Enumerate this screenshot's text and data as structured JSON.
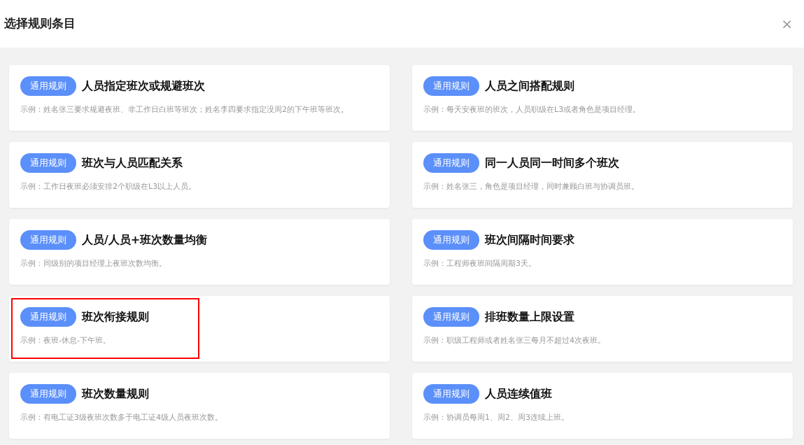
{
  "dialog": {
    "title": "选择规则条目",
    "close": "×"
  },
  "rules": [
    {
      "tag": "通用规则",
      "title": "人员指定班次或规避班次",
      "example": "示例：姓名张三要求规避夜班、非工作日白班等班次；姓名李四要求指定没周2的下午班等班次。",
      "highlighted": false
    },
    {
      "tag": "通用规则",
      "title": "人员之间搭配规则",
      "example": "示例：每天安夜班的班次，人员职级在L3或者角色是项目经理。",
      "highlighted": false
    },
    {
      "tag": "通用规则",
      "title": "班次与人员匹配关系",
      "example": "示例：工作日夜班必须安排2个职级在L3以上人员。",
      "highlighted": false
    },
    {
      "tag": "通用规则",
      "title": "同一人员同一时间多个班次",
      "example": "示例：姓名张三，角色是项目经理，同时兼顾白班与协调员班。",
      "highlighted": false
    },
    {
      "tag": "通用规则",
      "title": "人员/人员+班次数量均衡",
      "example": "示例：同级别的项目经理上夜班次数均衡。",
      "highlighted": false
    },
    {
      "tag": "通用规则",
      "title": "班次间隔时间要求",
      "example": "示例：工程师夜班间隔周期3天。",
      "highlighted": false
    },
    {
      "tag": "通用规则",
      "title": "班次衔接规则",
      "example": "示例：夜班-休息-下午班。",
      "highlighted": true
    },
    {
      "tag": "通用规则",
      "title": "排班数量上限设置",
      "example": "示例：职级工程师或者姓名张三每月不超过4次夜班。",
      "highlighted": false
    },
    {
      "tag": "通用规则",
      "title": "班次数量规则",
      "example": "示例：有电工证3级夜班次数多于电工证4级人员夜班次数。",
      "highlighted": false
    },
    {
      "tag": "通用规则",
      "title": "人员连续值班",
      "example": "示例：协调员每周1、周2、周3连续上班。",
      "highlighted": false
    }
  ]
}
